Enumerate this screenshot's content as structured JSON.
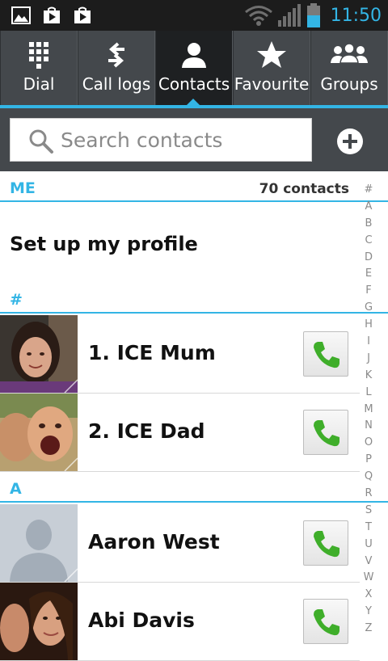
{
  "status_bar": {
    "time": "11:50",
    "icons": [
      "gallery-notification-icon",
      "play-store-notification-icon",
      "play-store-notification-icon",
      "wifi-icon",
      "signal-icon",
      "battery-icon"
    ],
    "accent": "#33b5e5"
  },
  "tabs": [
    {
      "label": "Dial",
      "icon": "dialpad-icon",
      "active": false
    },
    {
      "label": "Call logs",
      "icon": "call-logs-icon",
      "active": false
    },
    {
      "label": "Contacts",
      "icon": "person-icon",
      "active": true
    },
    {
      "label": "Favourite",
      "icon": "star-icon",
      "active": false
    },
    {
      "label": "Groups",
      "icon": "group-icon",
      "active": false
    }
  ],
  "search": {
    "placeholder": "Search contacts",
    "value": ""
  },
  "me_section": {
    "header": "ME",
    "count": "70 contacts",
    "profile_text": "Set up my profile"
  },
  "sections": [
    {
      "header": "#",
      "contacts": [
        "1. ICE Mum",
        "2. ICE Dad"
      ]
    },
    {
      "header": "A",
      "contacts": [
        "Aaron West",
        "Abi Davis"
      ]
    }
  ],
  "index": [
    "#",
    "A",
    "B",
    "C",
    "D",
    "E",
    "F",
    "G",
    "H",
    "I",
    "J",
    "K",
    "L",
    "M",
    "N",
    "O",
    "P",
    "Q",
    "R",
    "S",
    "T",
    "U",
    "V",
    "W",
    "X",
    "Y",
    "Z"
  ],
  "colors": {
    "accent": "#33b5e5",
    "call_green": "#3fae2a",
    "tabbar": "#44484c"
  }
}
